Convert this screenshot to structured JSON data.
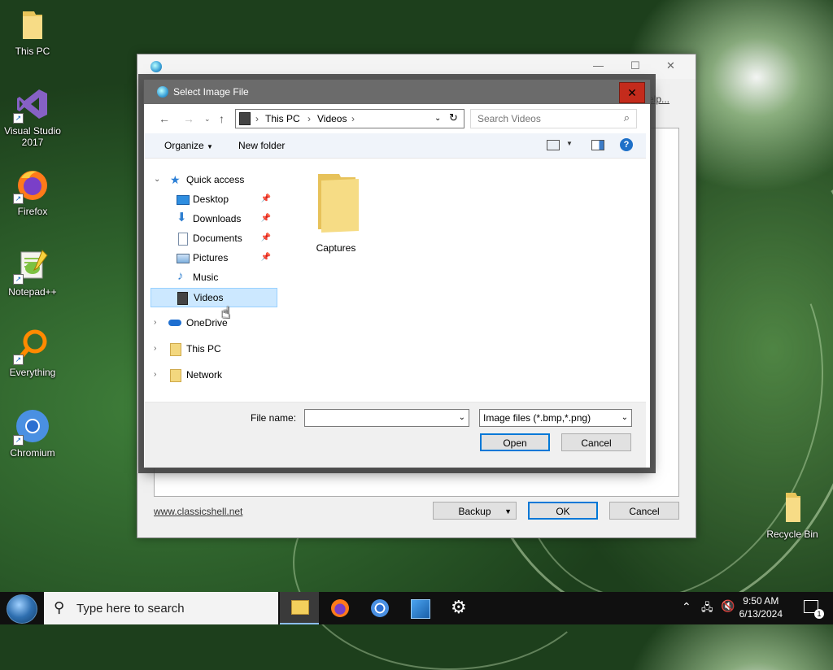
{
  "desktop": {
    "icons": [
      {
        "label": "This PC"
      },
      {
        "label": "Visual Studio 2017"
      },
      {
        "label": "Firefox"
      },
      {
        "label": "Notepad++"
      },
      {
        "label": "Everything"
      },
      {
        "label": "Chromium"
      },
      {
        "label": "Recycle Bin"
      }
    ]
  },
  "bg_window": {
    "help_link": "elp...",
    "site_link": "www.classicshell.net",
    "backup_label": "Backup",
    "ok_label": "OK",
    "cancel_label": "Cancel"
  },
  "dialog": {
    "title": "Select Image File",
    "close_label": "✕",
    "address": [
      "This PC",
      "Videos"
    ],
    "search_placeholder": "Search Videos",
    "toolbar": {
      "organize": "Organize",
      "new_folder": "New folder"
    },
    "nav": {
      "quick_access": "Quick access",
      "pinned": [
        {
          "label": "Desktop",
          "pinned": true
        },
        {
          "label": "Downloads",
          "pinned": true
        },
        {
          "label": "Documents",
          "pinned": true
        },
        {
          "label": "Pictures",
          "pinned": true
        },
        {
          "label": "Music",
          "pinned": false
        },
        {
          "label": "Videos",
          "pinned": false,
          "selected": true
        }
      ],
      "roots": [
        {
          "label": "OneDrive"
        },
        {
          "label": "This PC"
        },
        {
          "label": "Network"
        }
      ]
    },
    "files": [
      {
        "name": "Captures",
        "type": "folder"
      }
    ],
    "file_name_label": "File name:",
    "file_name_value": "",
    "file_type_value": "Image files (*.bmp,*.png)",
    "open_label": "Open",
    "cancel_label": "Cancel"
  },
  "taskbar": {
    "search_placeholder": "Type here to search",
    "time": "9:50 AM",
    "date": "6/13/2024",
    "notification_count": "1"
  },
  "colors": {
    "accent": "#0078d7",
    "close_red": "#c42b1c",
    "selection": "#cce8ff"
  }
}
